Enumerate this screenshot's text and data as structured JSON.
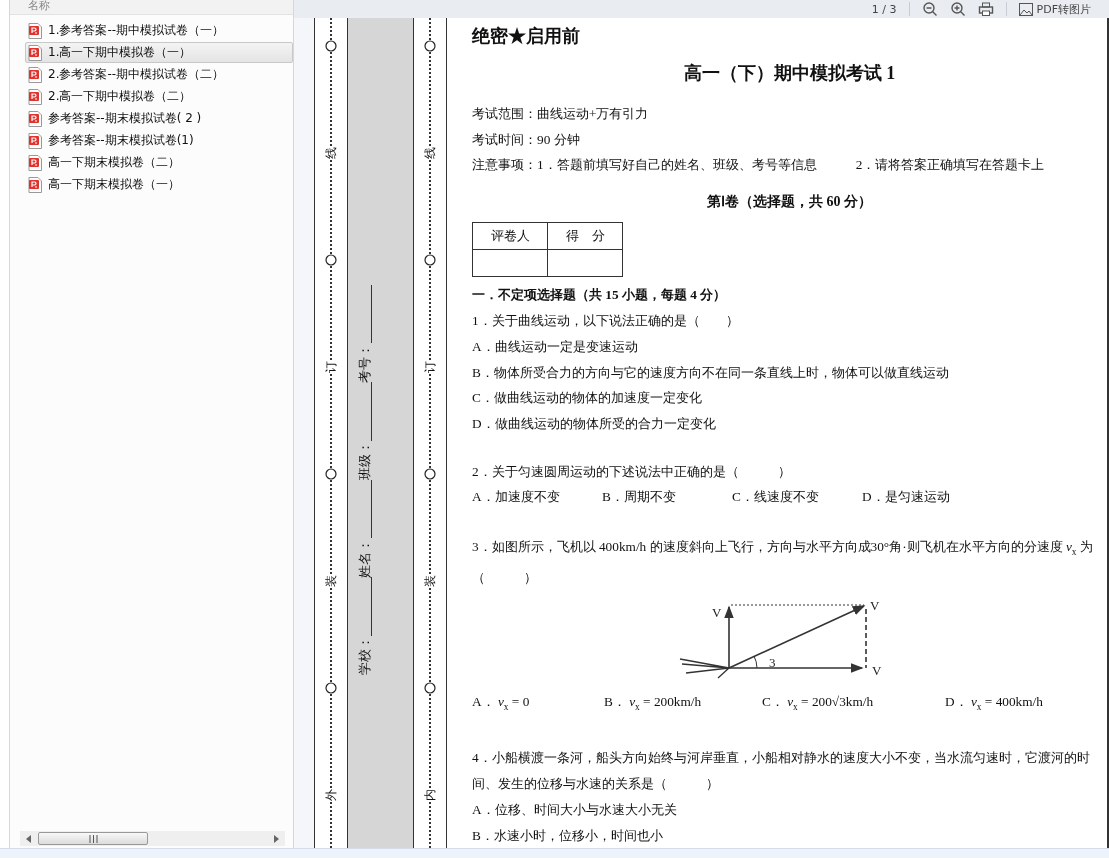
{
  "toolbar": {
    "page_indicator": "1 / 3",
    "convert_button": "PDF转图片"
  },
  "file_panel": {
    "column_header": "名称",
    "files": [
      {
        "name": "1.参考答案--期中模拟试卷（一）",
        "selected": false
      },
      {
        "name": "1.高一下期中模拟卷（一）",
        "selected": true
      },
      {
        "name": "2.参考答案--期中模拟试卷（二）",
        "selected": false
      },
      {
        "name": "2.高一下期中模拟卷（二）",
        "selected": false
      },
      {
        "name": "参考答案--期末模拟试卷( 2 )",
        "selected": false
      },
      {
        "name": "参考答案--期末模拟试卷(1)",
        "selected": false
      },
      {
        "name": "高一下期末模拟卷（二）",
        "selected": false
      },
      {
        "name": "高一下期末模拟卷（一）",
        "selected": false
      }
    ]
  },
  "binding": {
    "outer_marks": [
      "线",
      "订",
      "装",
      "外"
    ],
    "inner_marks": [
      "线",
      "订",
      "装",
      "内"
    ],
    "fields": [
      "学校：",
      "姓名：",
      "班级：",
      "考号："
    ]
  },
  "exam": {
    "confidential": "绝密★启用前",
    "title": "高一（下）期中模拟考试 1",
    "info": [
      "考试范围：曲线运动+万有引力",
      "考试时间：90 分钟",
      "注意事项：1．答题前填写好自己的姓名、班级、考号等信息　　　2．请将答案正确填写在答题卡上"
    ],
    "part_title": "第Ⅰ卷（选择题，共 60 分）",
    "score_table": {
      "columns": [
        "评卷人",
        "得　分"
      ]
    },
    "section_title": "一．不定项选择题（共 15 小题，每题 4 分）",
    "questions": [
      {
        "kind": "stack",
        "stem": "1．关于曲线运动，以下说法正确的是（　　）",
        "options": [
          "A．曲线运动一定是变速运动",
          "B．物体所受合力的方向与它的速度方向不在同一条直线上时，物体可以做直线运动",
          "C．做曲线运动的物体的加速度一定变化",
          "D．做曲线运动的物体所受的合力一定变化"
        ]
      },
      {
        "kind": "row",
        "stem": "2．关于匀速圆周运动的下述说法中正确的是（　　　）",
        "options": [
          "A．加速度不变",
          "B．周期不变",
          "C．线速度不变",
          "D．是匀速运动"
        ]
      },
      {
        "kind": "figure",
        "stem": "3．如图所示，飞机以 400km/h 的速度斜向上飞行，方向与水平方向成30°角·则飞机在水平方向的分速度 *v*$_{x}$ 为（　　　）",
        "figure_labels": [
          "V",
          "V",
          "V",
          "3"
        ],
        "options": [
          "A．  *v*$_{x}$ = 0",
          "B．  *v*$_{x}$ = 200km/h",
          "C．  *v*$_{x}$ = 200√3km/h",
          "D．  *v*$_{x}$ = 400km/h"
        ]
      },
      {
        "kind": "stack",
        "stem": "4．小船横渡一条河，船头方向始终与河岸垂直，小船相对静水的速度大小不变，当水流匀速时，它渡河的时间、发生的位移与水速的关系是（　　　）",
        "options": [
          "A．位移、时间大小与水速大小无关",
          "B．水速小时，位移小，时间也小"
        ]
      }
    ]
  }
}
